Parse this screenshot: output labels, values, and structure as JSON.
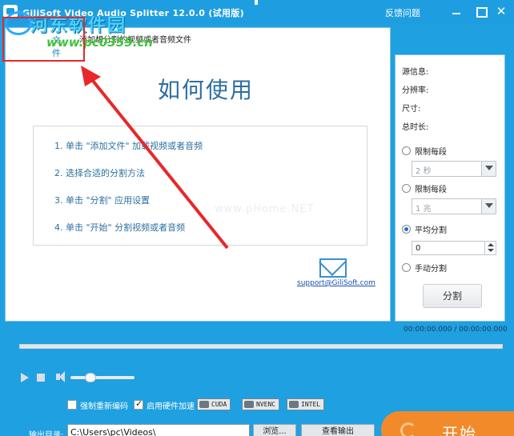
{
  "window": {
    "title": "GiliSoft Video Audio Splitter 12.0.0 (试用版)",
    "feedback_label": "反馈问题"
  },
  "watermark": {
    "site_name": "河东软件园",
    "site_url": "www.pc0359.cn",
    "center_text": "www.pHome.NET"
  },
  "main": {
    "add_file_label": "文件",
    "hint": "添加想分割的视频或者音频文件",
    "howto_title": "如何使用",
    "steps": [
      "1. 单击 \"添加文件\" 加载视频或者音频",
      "2. 选择合适的分割方法",
      "3. 单击 \"分割\" 应用设置",
      "4. 单击 \"开始\" 分割视频或者音频"
    ],
    "support_email": "support@GiliSoft.com"
  },
  "side": {
    "info_labels": [
      "源信息:",
      "分辨率:",
      "尺寸:",
      "总时长:"
    ],
    "option_limit_time": "限制每段",
    "combo_time": "2 秒",
    "option_limit_size": "限制每段",
    "combo_size": "1 兆",
    "option_average": "平均分割",
    "average_value": "0",
    "option_manual": "手动分割",
    "split_button": "分割",
    "selected_option": "平均分割"
  },
  "player": {
    "time_readout": "00:00:00.000 / 00:00:00.000",
    "volume_level": 0.25
  },
  "options": {
    "force_reencode_label": "强制重新编码",
    "force_reencode_checked": false,
    "hw_accel_label": "启用硬件加速",
    "hw_accel_checked": true,
    "hw_badges": [
      "CUDA",
      "NVENC",
      "INTEL"
    ]
  },
  "output": {
    "dir_label": "输出目录:",
    "dir_value": "C:\\Users\\pc\\Videos\\",
    "browse_label": "浏览...",
    "view_output_label": "查看输出",
    "start_label": "开始"
  },
  "colors": {
    "accent": "#1e9ee0",
    "start_button": "#f28a2a",
    "annotation": "#e8272a"
  }
}
